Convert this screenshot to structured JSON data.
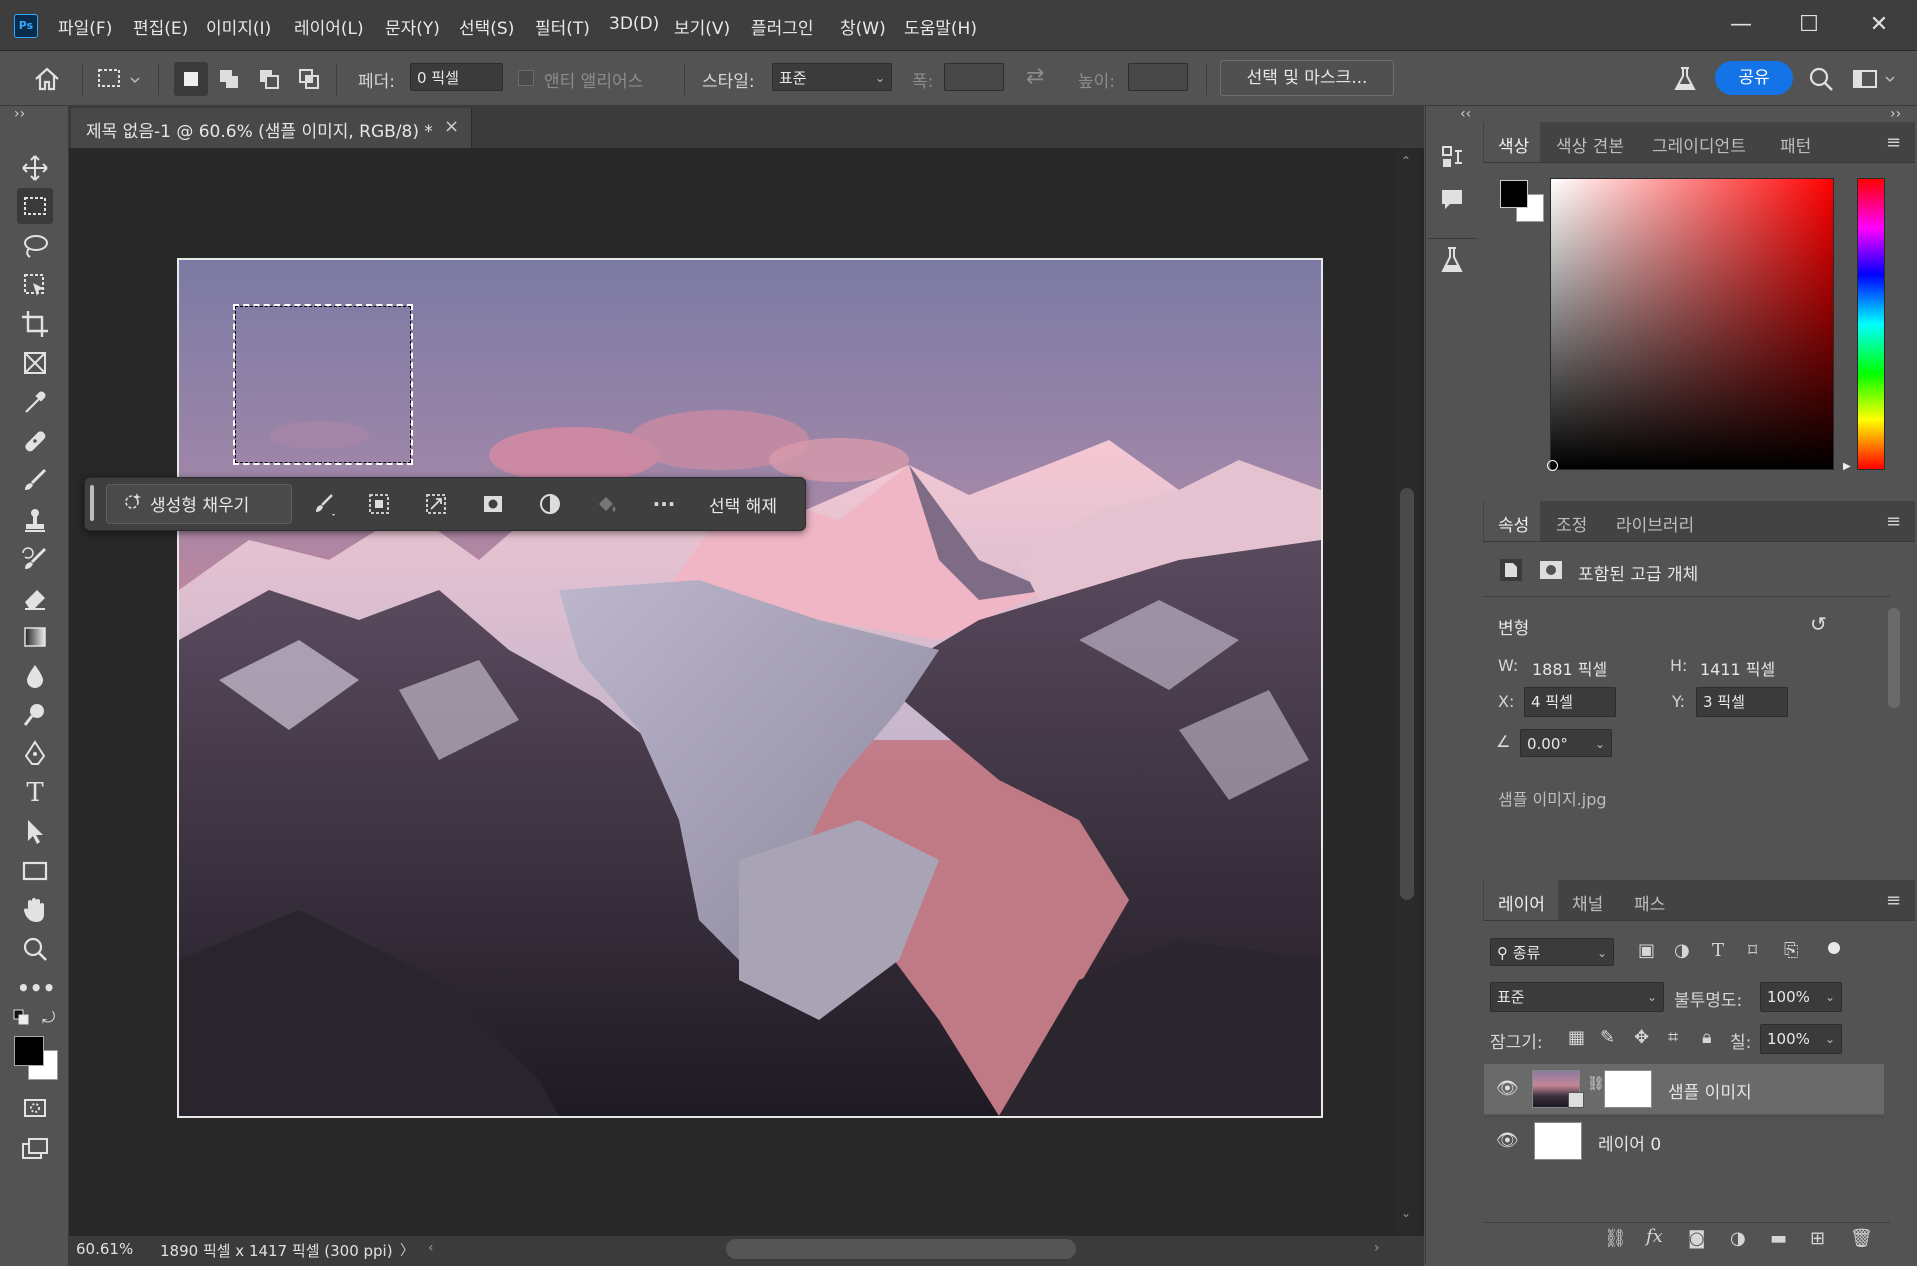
{
  "app": {
    "logo": "Ps",
    "menu": [
      "파일(F)",
      "편집(E)",
      "이미지(I)",
      "레이어(L)",
      "문자(Y)",
      "선택(S)",
      "필터(T)",
      "3D(D)",
      "보기(V)",
      "플러그인",
      "창(W)",
      "도움말(H)"
    ],
    "window_controls": {
      "minimize": "—",
      "maximize": "☐",
      "close": "✕"
    }
  },
  "options": {
    "feather_label": "페더:",
    "feather_value": "0 픽셀",
    "antialias_label": "앤티 앨리어스",
    "style_label": "스타일:",
    "style_value": "표준",
    "width_label": "폭:",
    "height_label": "높이:",
    "select_mask_button": "선택 및 마스크...",
    "share_button": "공유"
  },
  "document": {
    "tab_title": "제목 없음-1 @ 60.6% (샘플 이미지, RGB/8) *",
    "tab_close": "×"
  },
  "context_bar": {
    "generative_fill": "생성형 채우기",
    "more": "···",
    "deselect": "선택 해제"
  },
  "status": {
    "zoom": "60.61%",
    "doc_info": "1890 픽셀 x 1417 픽셀 (300 ppi)",
    "arrow": "〉"
  },
  "color_panel": {
    "tabs": [
      "색상",
      "색상 견본",
      "그레이디언트",
      "패턴"
    ],
    "active_tab": 0,
    "foreground": "#000000",
    "background": "#ffffff"
  },
  "properties_panel": {
    "tabs": [
      "속성",
      "조정",
      "라이브러리"
    ],
    "active_tab": 0,
    "type_label": "포함된 고급 개체",
    "transform_label": "변형",
    "w_label": "W:",
    "w_value": "1881 픽셀",
    "h_label": "H:",
    "h_value": "1411 픽셀",
    "x_label": "X:",
    "x_value": "4 픽셀",
    "y_label": "Y:",
    "y_value": "3 픽셀",
    "angle_value": "0.00°",
    "filename": "샘플 이미지.jpg"
  },
  "layers_panel": {
    "tabs": [
      "레이어",
      "채널",
      "패스"
    ],
    "active_tab": 0,
    "filter_label": "종류",
    "blend_mode": "표준",
    "opacity_label": "불투명도:",
    "opacity_value": "100%",
    "lock_label": "잠그기:",
    "fill_label": "칠:",
    "fill_value": "100%",
    "layers": [
      {
        "name": "샘플 이미지",
        "selected": true
      },
      {
        "name": "레이어 0",
        "selected": false
      }
    ]
  },
  "colors": {
    "accent": "#1473e6",
    "chrome": "#535353",
    "workspace": "#282828"
  }
}
